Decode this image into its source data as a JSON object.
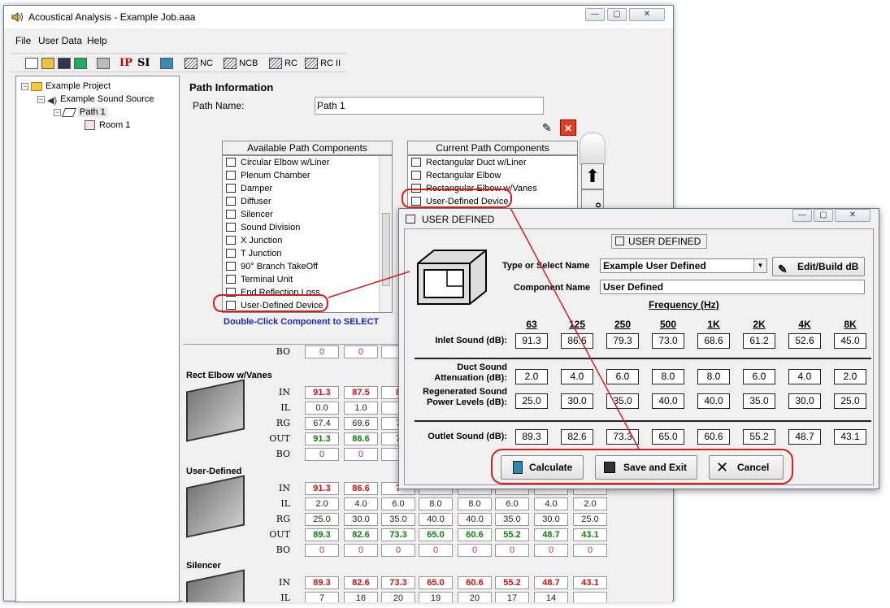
{
  "window": {
    "title": "Acoustical Analysis - Example Job.aaa",
    "min": "—",
    "max": "▢",
    "close": "✕"
  },
  "menu": [
    "File",
    "User Data",
    "Help"
  ],
  "toolbar": {
    "ip": "IP",
    "si": "SI",
    "nc": "NC",
    "ncb": "NCB",
    "rc": "RC",
    "rc2": "RC II"
  },
  "tree": {
    "project": "Example Project",
    "source": "Example Sound Source",
    "path": "Path 1",
    "room": "Room 1"
  },
  "path_info": {
    "heading": "Path Information",
    "name_label": "Path Name:",
    "name_value": "Path 1"
  },
  "available": {
    "title": "Available Path Components",
    "items": [
      "Circular Elbow w/Liner",
      "Plenum Chamber",
      "Damper",
      "Diffuser",
      "Silencer",
      "Sound Division",
      "X Junction",
      "T Junction",
      "90° Branch TakeOff",
      "Terminal Unit",
      "End Reflection Loss",
      "User-Defined Device"
    ],
    "hint": "Double-Click Component to SELECT"
  },
  "current": {
    "title": "Current Path Components",
    "items": [
      "Rectangular Duct w/Liner",
      "Rectangular Elbow",
      "Rectangular Elbow w/Vanes",
      "User-Defined Device"
    ]
  },
  "reorder_label": "order",
  "grid": {
    "top": {
      "out_label": "OUT",
      "bo_label": "BO",
      "bo": [
        "0",
        "0"
      ]
    },
    "blocks": [
      {
        "name": "Rect Elbow w/Vanes",
        "rows": [
          {
            "label": "IN",
            "v": [
              "91.3",
              "87.5",
              "8"
            ]
          },
          {
            "label": "IL",
            "v": [
              "0.0",
              "1.0"
            ]
          },
          {
            "label": "RG",
            "v": [
              "67.4",
              "69.6",
              "7"
            ]
          },
          {
            "label": "OUT",
            "v": [
              "91.3",
              "86.6",
              "7"
            ]
          },
          {
            "label": "BO",
            "v": [
              "0",
              "0"
            ]
          }
        ]
      },
      {
        "name": "User-Defined",
        "rows": [
          {
            "label": "IN",
            "v": [
              "91.3",
              "86.6",
              "7"
            ]
          },
          {
            "label": "IL",
            "v": [
              "2.0",
              "4.0",
              "6.0",
              "8.0",
              "8.0",
              "6.0",
              "4.0",
              "2.0"
            ]
          },
          {
            "label": "RG",
            "v": [
              "25.0",
              "30.0",
              "35.0",
              "40.0",
              "40.0",
              "35.0",
              "30.0",
              "25.0"
            ]
          },
          {
            "label": "OUT",
            "v": [
              "89.3",
              "82.6",
              "73.3",
              "65.0",
              "60.6",
              "55.2",
              "48.7",
              "43.1"
            ]
          },
          {
            "label": "BO",
            "v": [
              "0",
              "0",
              "0",
              "0",
              "0",
              "0",
              "0",
              "0"
            ]
          }
        ]
      },
      {
        "name": "Silencer",
        "rows": [
          {
            "label": "IN",
            "v": [
              "89.3",
              "82.6",
              "73.3",
              "65.0",
              "60.6",
              "55.2",
              "48.7",
              "43.1"
            ]
          },
          {
            "label": "IL",
            "v": [
              "7",
              "16",
              "20",
              "19",
              "20",
              "17",
              "14"
            ]
          }
        ]
      }
    ]
  },
  "dialog": {
    "title": "USER DEFINED",
    "group_title": "USER DEFINED",
    "type_label": "Type or Select Name",
    "type_value": "Example User Defined",
    "edit_button": "Edit/Build dB",
    "comp_label": "Component Name",
    "comp_value": "User Defined",
    "freq_title": "Frequency (Hz)",
    "freqs": [
      "63",
      "125",
      "250",
      "500",
      "1K",
      "2K",
      "4K",
      "8K"
    ],
    "inlet_label": "Inlet Sound (dB):",
    "inlet": [
      "91.3",
      "86.6",
      "79.3",
      "73.0",
      "68.6",
      "61.2",
      "52.6",
      "45.0"
    ],
    "duct_label": "Duct Sound Attenuation (dB):",
    "duct": [
      "2.0",
      "4.0",
      "6.0",
      "8.0",
      "8.0",
      "6.0",
      "4.0",
      "2.0"
    ],
    "regen_label": "Regenerated Sound Power Levels (dB):",
    "regen": [
      "25.0",
      "30.0",
      "35.0",
      "40.0",
      "40.0",
      "35.0",
      "30.0",
      "25.0"
    ],
    "outlet_label": "Outlet Sound (dB):",
    "outlet": [
      "89.3",
      "82.6",
      "73.3",
      "65.0",
      "60.6",
      "55.2",
      "48.7",
      "43.1"
    ],
    "calc": "Calculate",
    "save": "Save and Exit",
    "cancel": "Cancel"
  }
}
